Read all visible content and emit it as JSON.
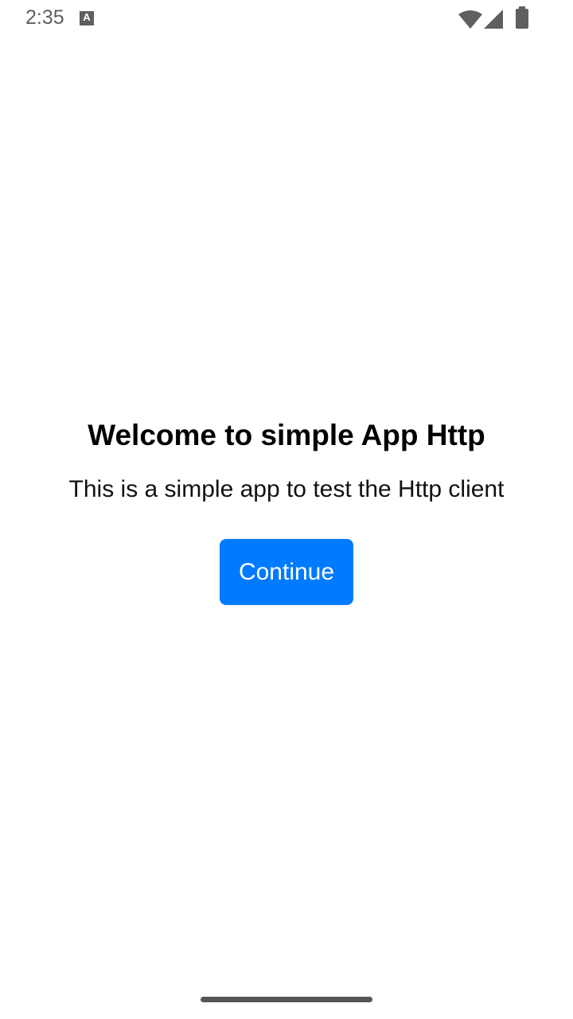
{
  "status_bar": {
    "time": "2:35",
    "notification_icon": "A",
    "icons": [
      "wifi-icon",
      "signal-icon",
      "battery-icon"
    ]
  },
  "main": {
    "title": "Welcome to simple App Http",
    "subtitle": "This is a simple app to test the Http client",
    "continue_label": "Continue"
  },
  "colors": {
    "accent": "#007aff"
  }
}
